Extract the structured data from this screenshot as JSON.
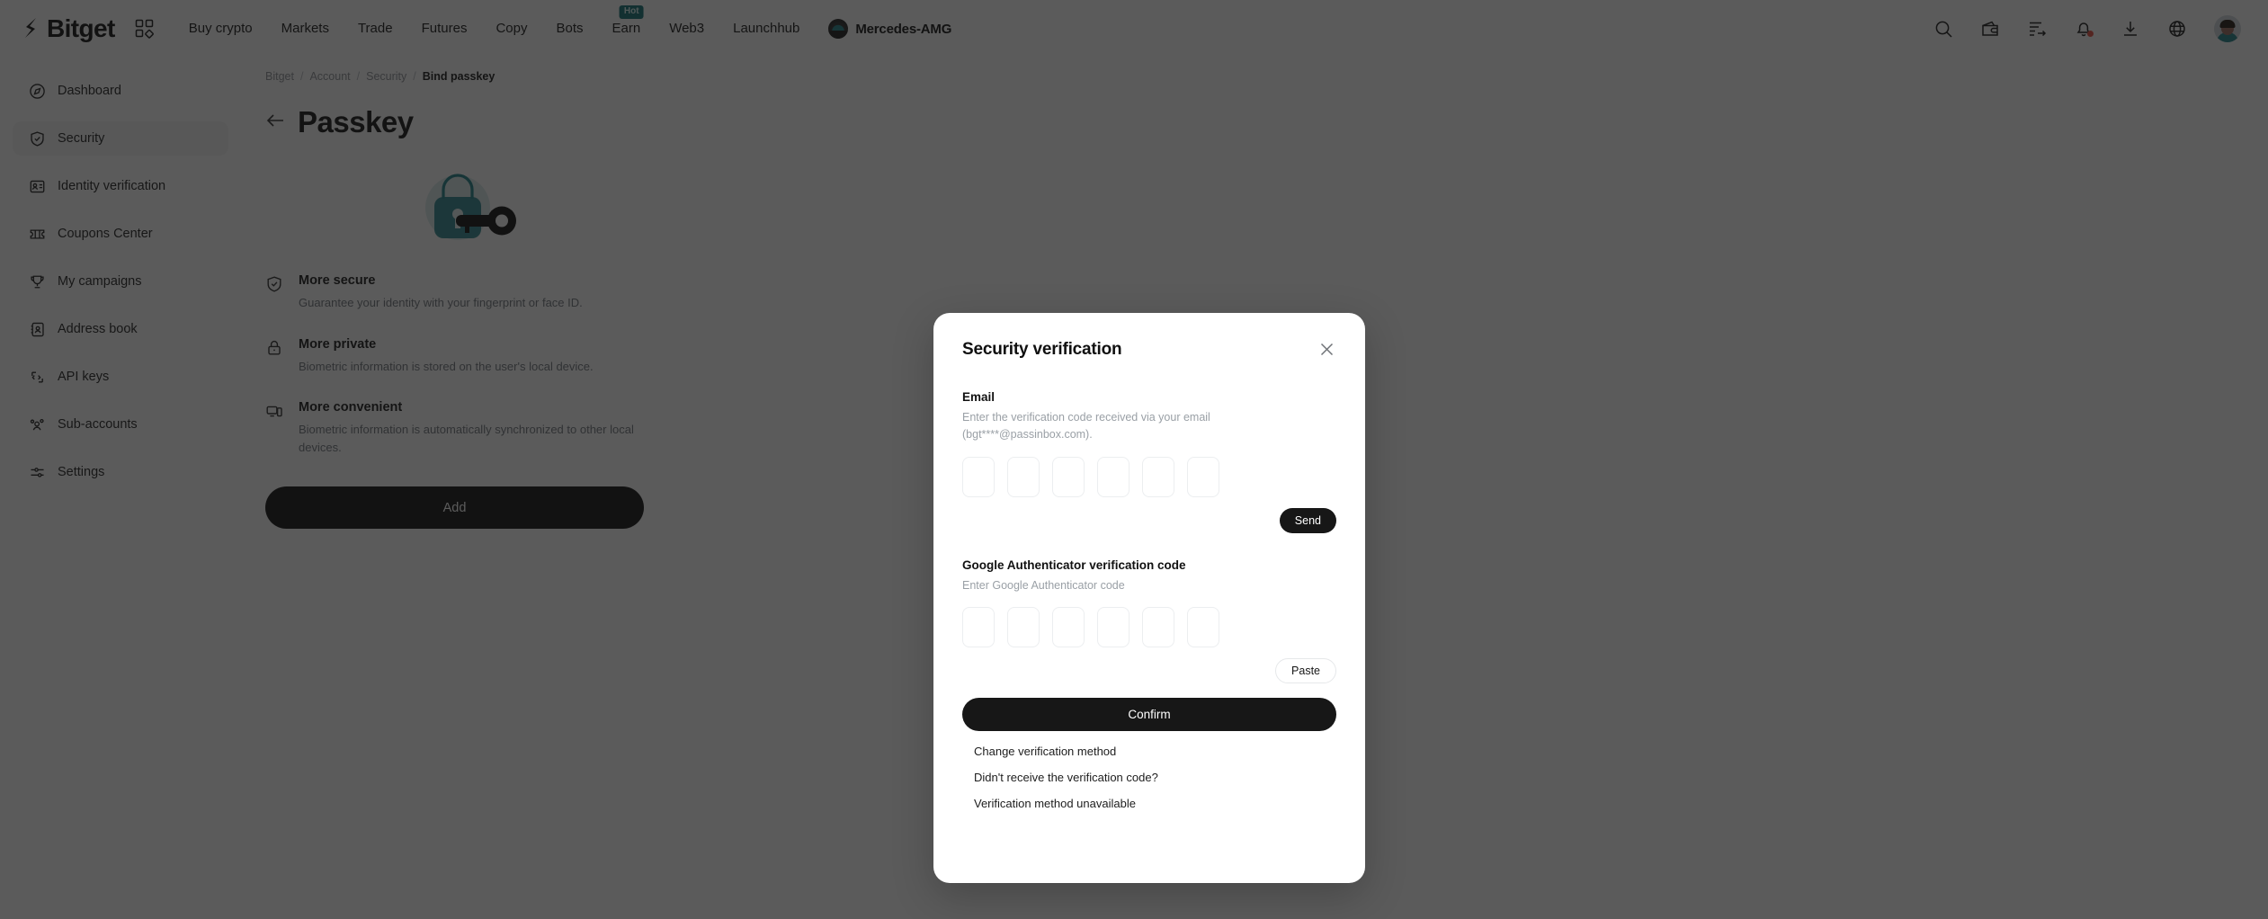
{
  "topnav": {
    "brand": "Bitget",
    "brand_icon": "bitget-logo-icon",
    "apps_icon": "grid-apps-icon",
    "links": [
      {
        "label": "Buy crypto",
        "badge": ""
      },
      {
        "label": "Markets",
        "badge": ""
      },
      {
        "label": "Trade",
        "badge": ""
      },
      {
        "label": "Futures",
        "badge": ""
      },
      {
        "label": "Copy",
        "badge": ""
      },
      {
        "label": "Bots",
        "badge": ""
      },
      {
        "label": "Earn",
        "badge": "Hot"
      },
      {
        "label": "Web3",
        "badge": ""
      },
      {
        "label": "Launchhub",
        "badge": ""
      }
    ],
    "sponsor": "Mercedes-AMG",
    "icons": [
      "search-icon",
      "wallet-icon",
      "orders-icon",
      "bell-notification-icon",
      "download-icon",
      "globe-language-icon",
      "avatar"
    ]
  },
  "sidebar": {
    "items": [
      {
        "label": "Dashboard",
        "icon": "compass-icon",
        "active": false
      },
      {
        "label": "Security",
        "icon": "shield-check-icon",
        "active": true
      },
      {
        "label": "Identity verification",
        "icon": "id-card-icon",
        "active": false
      },
      {
        "label": "Coupons Center",
        "icon": "ticket-icon",
        "active": false
      },
      {
        "label": "My campaigns",
        "icon": "trophy-icon",
        "active": false
      },
      {
        "label": "Address book",
        "icon": "address-book-icon",
        "active": false
      },
      {
        "label": "API keys",
        "icon": "code-brackets-icon",
        "active": false
      },
      {
        "label": "Sub-accounts",
        "icon": "users-icon",
        "active": false
      },
      {
        "label": "Settings",
        "icon": "sliders-icon",
        "active": false
      }
    ]
  },
  "breadcrumb": {
    "items": [
      "Bitget",
      "Account",
      "Security"
    ],
    "current": "Bind passkey",
    "separator": "/"
  },
  "page": {
    "title": "Passkey",
    "back_icon": "back-arrow-icon",
    "hero_icon": "passkey-lock-key-illustration",
    "features": [
      {
        "icon": "shield-check-icon",
        "title": "More secure",
        "desc": "Guarantee your identity with your fingerprint or face ID."
      },
      {
        "icon": "lock-icon",
        "title": "More private",
        "desc": "Biometric information is stored on the user's local device."
      },
      {
        "icon": "devices-icon",
        "title": "More convenient",
        "desc": "Biometric information is automatically synchronized to other local devices."
      }
    ],
    "add_button": "Add"
  },
  "modal": {
    "title": "Security verification",
    "close_icon": "close-x-icon",
    "email": {
      "label": "Email",
      "hint": "Enter the verification code received via your email (bgt****@passinbox.com).",
      "code_length": 6,
      "values": [
        "",
        "",
        "",
        "",
        "",
        ""
      ],
      "send_button": "Send"
    },
    "authenticator": {
      "label": "Google Authenticator verification code",
      "hint": "Enter Google Authenticator code",
      "code_length": 6,
      "values": [
        "",
        "",
        "",
        "",
        "",
        ""
      ],
      "paste_button": "Paste"
    },
    "confirm_button": "Confirm",
    "links": [
      "Change verification method",
      "Didn't receive the verification code?",
      "Verification method unavailable"
    ]
  },
  "colors": {
    "accent_teal": "#1d7f88",
    "badge_hot_bg": "#0e6f74",
    "primary_button": "#0b0b0b",
    "overlay": "rgba(22,22,22,0.70)"
  }
}
